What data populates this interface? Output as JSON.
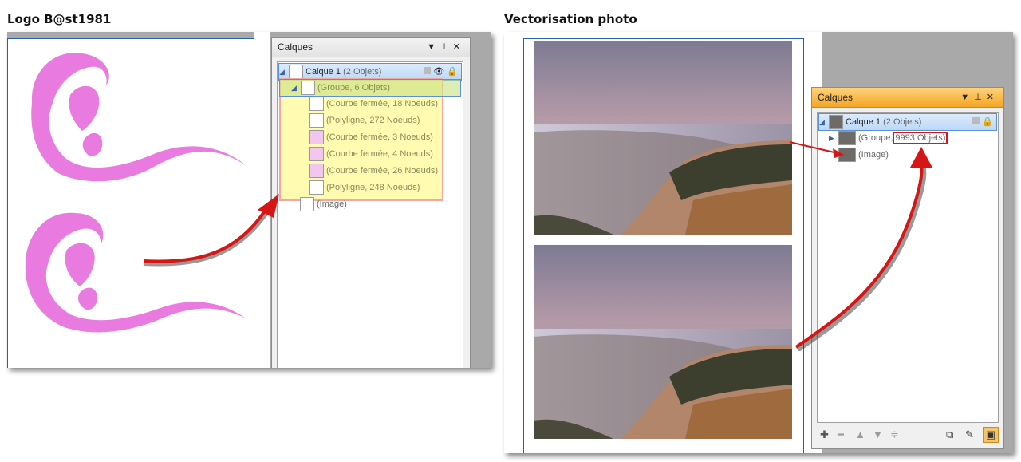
{
  "headings": {
    "left": "Logo B@st1981",
    "right": "Vectorisation photo"
  },
  "left_panel": {
    "title": "Calques",
    "layer": {
      "name": "Calque 1",
      "count": "(2 Objets)"
    },
    "group": "(Groupe, 6 Objets)",
    "children": [
      "(Courbe fermée, 18 Noeuds)",
      "(Polyligne, 272 Noeuds)",
      "(Courbe fermée, 3 Noeuds)",
      "(Courbe fermée, 4 Noeuds)",
      "(Courbe fermée, 26 Noeuds)",
      "(Polyligne, 248 Noeuds)"
    ],
    "image": "(Image)"
  },
  "right_panel": {
    "title": "Calques",
    "layer": {
      "name": "Calque 1",
      "count": "(2 Objets)"
    },
    "group_prefix": "(Groupe,",
    "group_count": "9993 Objets)",
    "image": "(Image)"
  },
  "colors": {
    "logo_pink": "#e87ae0",
    "arrow_red": "#d61515",
    "panel_orange": "#f5a623",
    "selection_blue": "#bcd8f7"
  },
  "icons": {
    "panel_title": [
      "dropdown-icon",
      "pin-icon",
      "close-icon"
    ],
    "layer_state": [
      "square-icon",
      "eye-icon",
      "lock-icon"
    ],
    "toolbar": [
      "add-icon",
      "remove-icon",
      "move-up-icon",
      "move-down-icon",
      "merge-icon",
      "select-icon",
      "edit-icon",
      "view-icon"
    ]
  }
}
